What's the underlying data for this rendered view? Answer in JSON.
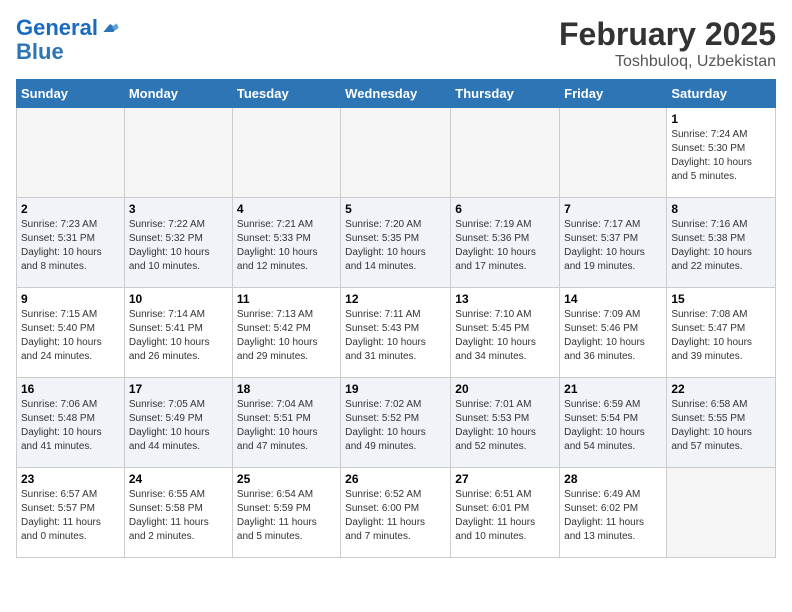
{
  "header": {
    "logo_line1": "General",
    "logo_line2": "Blue",
    "main_title": "February 2025",
    "sub_title": "Toshbuloq, Uzbekistan"
  },
  "days_of_week": [
    "Sunday",
    "Monday",
    "Tuesday",
    "Wednesday",
    "Thursday",
    "Friday",
    "Saturday"
  ],
  "weeks": [
    [
      {
        "day": "",
        "info": ""
      },
      {
        "day": "",
        "info": ""
      },
      {
        "day": "",
        "info": ""
      },
      {
        "day": "",
        "info": ""
      },
      {
        "day": "",
        "info": ""
      },
      {
        "day": "",
        "info": ""
      },
      {
        "day": "1",
        "info": "Sunrise: 7:24 AM\nSunset: 5:30 PM\nDaylight: 10 hours\nand 5 minutes."
      }
    ],
    [
      {
        "day": "2",
        "info": "Sunrise: 7:23 AM\nSunset: 5:31 PM\nDaylight: 10 hours\nand 8 minutes."
      },
      {
        "day": "3",
        "info": "Sunrise: 7:22 AM\nSunset: 5:32 PM\nDaylight: 10 hours\nand 10 minutes."
      },
      {
        "day": "4",
        "info": "Sunrise: 7:21 AM\nSunset: 5:33 PM\nDaylight: 10 hours\nand 12 minutes."
      },
      {
        "day": "5",
        "info": "Sunrise: 7:20 AM\nSunset: 5:35 PM\nDaylight: 10 hours\nand 14 minutes."
      },
      {
        "day": "6",
        "info": "Sunrise: 7:19 AM\nSunset: 5:36 PM\nDaylight: 10 hours\nand 17 minutes."
      },
      {
        "day": "7",
        "info": "Sunrise: 7:17 AM\nSunset: 5:37 PM\nDaylight: 10 hours\nand 19 minutes."
      },
      {
        "day": "8",
        "info": "Sunrise: 7:16 AM\nSunset: 5:38 PM\nDaylight: 10 hours\nand 22 minutes."
      }
    ],
    [
      {
        "day": "9",
        "info": "Sunrise: 7:15 AM\nSunset: 5:40 PM\nDaylight: 10 hours\nand 24 minutes."
      },
      {
        "day": "10",
        "info": "Sunrise: 7:14 AM\nSunset: 5:41 PM\nDaylight: 10 hours\nand 26 minutes."
      },
      {
        "day": "11",
        "info": "Sunrise: 7:13 AM\nSunset: 5:42 PM\nDaylight: 10 hours\nand 29 minutes."
      },
      {
        "day": "12",
        "info": "Sunrise: 7:11 AM\nSunset: 5:43 PM\nDaylight: 10 hours\nand 31 minutes."
      },
      {
        "day": "13",
        "info": "Sunrise: 7:10 AM\nSunset: 5:45 PM\nDaylight: 10 hours\nand 34 minutes."
      },
      {
        "day": "14",
        "info": "Sunrise: 7:09 AM\nSunset: 5:46 PM\nDaylight: 10 hours\nand 36 minutes."
      },
      {
        "day": "15",
        "info": "Sunrise: 7:08 AM\nSunset: 5:47 PM\nDaylight: 10 hours\nand 39 minutes."
      }
    ],
    [
      {
        "day": "16",
        "info": "Sunrise: 7:06 AM\nSunset: 5:48 PM\nDaylight: 10 hours\nand 41 minutes."
      },
      {
        "day": "17",
        "info": "Sunrise: 7:05 AM\nSunset: 5:49 PM\nDaylight: 10 hours\nand 44 minutes."
      },
      {
        "day": "18",
        "info": "Sunrise: 7:04 AM\nSunset: 5:51 PM\nDaylight: 10 hours\nand 47 minutes."
      },
      {
        "day": "19",
        "info": "Sunrise: 7:02 AM\nSunset: 5:52 PM\nDaylight: 10 hours\nand 49 minutes."
      },
      {
        "day": "20",
        "info": "Sunrise: 7:01 AM\nSunset: 5:53 PM\nDaylight: 10 hours\nand 52 minutes."
      },
      {
        "day": "21",
        "info": "Sunrise: 6:59 AM\nSunset: 5:54 PM\nDaylight: 10 hours\nand 54 minutes."
      },
      {
        "day": "22",
        "info": "Sunrise: 6:58 AM\nSunset: 5:55 PM\nDaylight: 10 hours\nand 57 minutes."
      }
    ],
    [
      {
        "day": "23",
        "info": "Sunrise: 6:57 AM\nSunset: 5:57 PM\nDaylight: 11 hours\nand 0 minutes."
      },
      {
        "day": "24",
        "info": "Sunrise: 6:55 AM\nSunset: 5:58 PM\nDaylight: 11 hours\nand 2 minutes."
      },
      {
        "day": "25",
        "info": "Sunrise: 6:54 AM\nSunset: 5:59 PM\nDaylight: 11 hours\nand 5 minutes."
      },
      {
        "day": "26",
        "info": "Sunrise: 6:52 AM\nSunset: 6:00 PM\nDaylight: 11 hours\nand 7 minutes."
      },
      {
        "day": "27",
        "info": "Sunrise: 6:51 AM\nSunset: 6:01 PM\nDaylight: 11 hours\nand 10 minutes."
      },
      {
        "day": "28",
        "info": "Sunrise: 6:49 AM\nSunset: 6:02 PM\nDaylight: 11 hours\nand 13 minutes."
      },
      {
        "day": "",
        "info": ""
      }
    ]
  ]
}
